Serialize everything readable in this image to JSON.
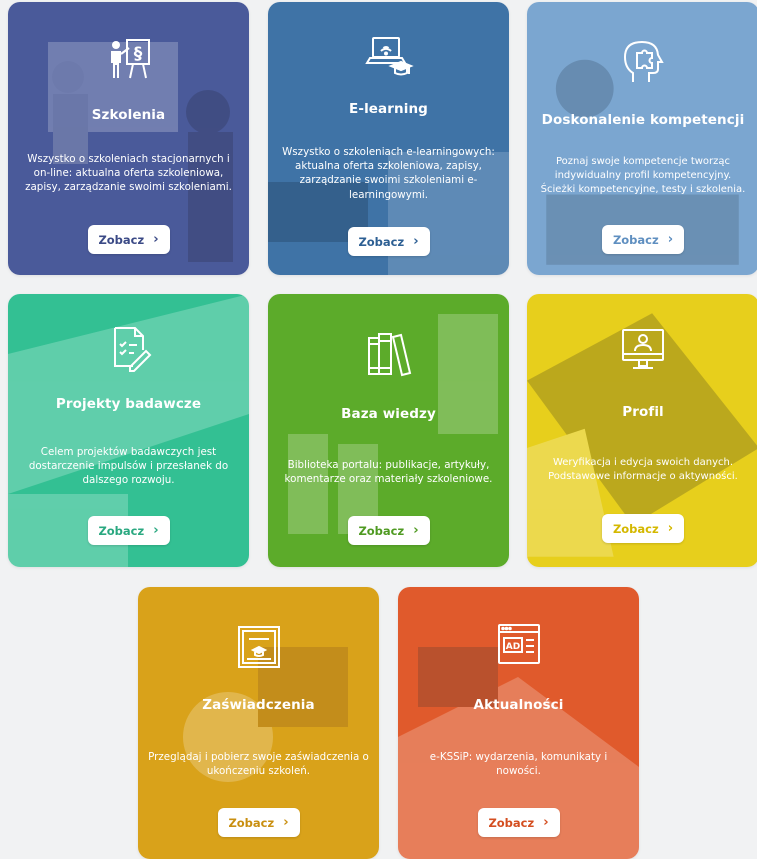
{
  "cards": [
    {
      "title": "Szkolenia",
      "description": "Wszystko o szkoleniach stacjonarnych i on-line: aktualna oferta szkoleniowa, zapisy, zarządzanie swoimi szkoleniami.",
      "button": "Zobacz",
      "chevron": "›",
      "icon": "teacher-board-icon",
      "color": "#4a5a9a",
      "button_color": "#3b4a86"
    },
    {
      "title": "E-learning",
      "description": "Wszystko o szkoleniach e-learningowych: aktualna oferta szkoleniowa, zapisy, zarządzanie swoimi szkoleniami e-learningowymi.",
      "button": "Zobacz",
      "chevron": "›",
      "icon": "laptop-graduation-icon",
      "color": "#3f73a6",
      "button_color": "#2d5f93"
    },
    {
      "title": "Doskonalenie kompetencji",
      "description": "Poznaj swoje kompetencje tworząc indywidualny profil kompetencyjny. Ścieżki kompetencyjne, testy i szkolenia.",
      "button": "Zobacz",
      "chevron": "›",
      "icon": "head-puzzle-icon",
      "color": "#7ba6d0",
      "button_color": "#5f8fc0"
    },
    {
      "title": "Projekty badawcze",
      "description": "Celem projektów badawczych jest dostarczenie impulsów i przesłanek do dalszego rozwoju.",
      "button": "Zobacz",
      "chevron": "›",
      "icon": "document-pen-icon",
      "color": "#33c093",
      "button_color": "#2aa880"
    },
    {
      "title": "Baza wiedzy",
      "description": "Biblioteka portalu: publikacje, artykuły, komentarze oraz materiały szkoleniowe.",
      "button": "Zobacz",
      "chevron": "›",
      "icon": "books-icon",
      "color": "#5cab2a",
      "button_color": "#4f9a22"
    },
    {
      "title": "Profil",
      "description": "Weryfikacja i edycja swoich danych. Podstawowe informacje o aktywności.",
      "button": "Zobacz",
      "chevron": "›",
      "icon": "monitor-user-icon",
      "color": "#e7cf1c",
      "button_color": "#d4b800"
    },
    {
      "title": "Zaświadczenia",
      "description": "Przeglądaj i pobierz swoje zaświadczenia o ukończeniu szkoleń.",
      "button": "Zobacz",
      "chevron": "›",
      "icon": "certificate-icon",
      "color": "#d9a21a",
      "button_color": "#c98f10"
    },
    {
      "title": "Aktualności",
      "description": "e-KSSiP: wydarzenia, komunikaty i nowości.",
      "button": "Zobacz",
      "chevron": "›",
      "icon": "news-ad-icon",
      "color": "#e05a2c",
      "button_color": "#d44e20"
    }
  ]
}
